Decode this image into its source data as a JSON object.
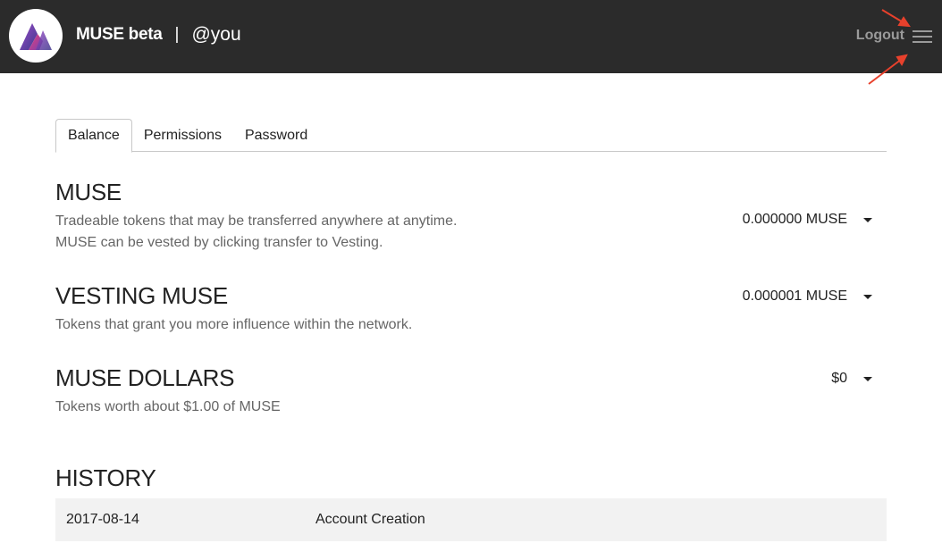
{
  "header": {
    "app_name": "MUSE beta",
    "separator": "|",
    "username": "@you",
    "logout_label": "Logout",
    "logo_icon": "muse-mountain-logo",
    "menu_icon": "hamburger-menu-icon",
    "annotation_color": "#e8412c"
  },
  "tabs": [
    {
      "label": "Balance",
      "active": true
    },
    {
      "label": "Permissions",
      "active": false
    },
    {
      "label": "Password",
      "active": false
    }
  ],
  "balances": [
    {
      "title": "MUSE",
      "description": [
        "Tradeable tokens that may be transferred anywhere at anytime.",
        "MUSE can be vested by clicking transfer to Vesting."
      ],
      "amount": "0.000000 MUSE"
    },
    {
      "title": "VESTING MUSE",
      "description": [
        "Tokens that grant you more influence within the network."
      ],
      "amount": "0.000001 MUSE"
    },
    {
      "title": "MUSE DOLLARS",
      "description": [
        "Tokens worth about $1.00 of MUSE"
      ],
      "amount": "$0"
    }
  ],
  "history": {
    "title": "HISTORY",
    "rows": [
      {
        "date": "2017-08-14",
        "event": "Account Creation"
      }
    ]
  }
}
